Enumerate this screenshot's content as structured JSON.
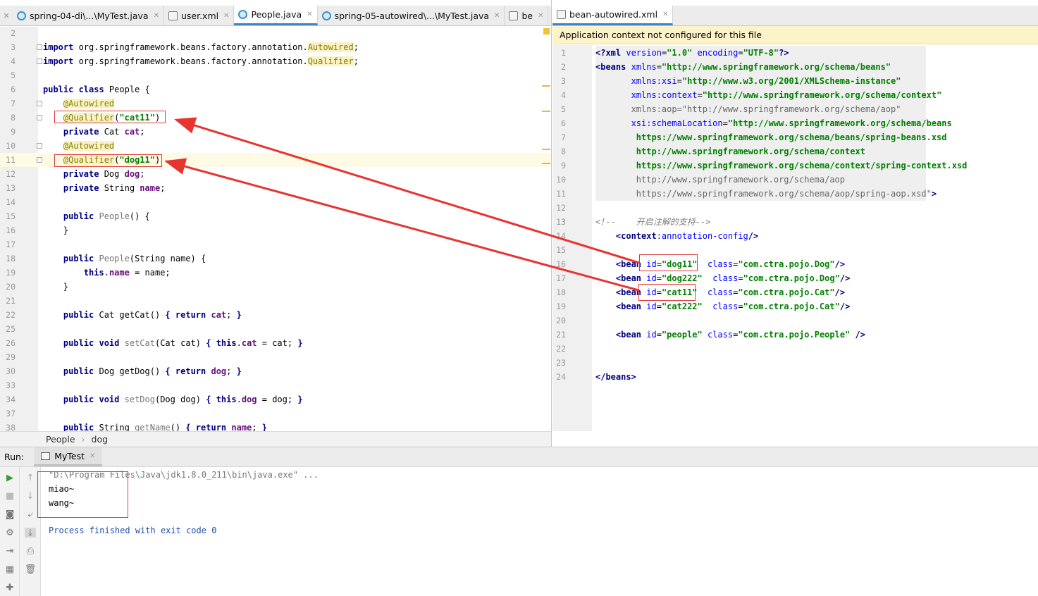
{
  "left_tabs": [
    {
      "label": "spring-04-di\\...\\MyTest.java",
      "icon": "java-class-icon"
    },
    {
      "label": "user.xml",
      "icon": "xml-file-icon"
    },
    {
      "label": "People.java",
      "icon": "java-class-icon",
      "active": true
    },
    {
      "label": "spring-05-autowired\\...\\MyTest.java",
      "icon": "java-class-icon"
    },
    {
      "label": "be",
      "icon": "xml-file-icon"
    }
  ],
  "left_tabs_overflow": "6",
  "right_tab": {
    "label": "bean-autowired.xml",
    "icon": "xml-file-icon"
  },
  "java_code": {
    "lines": [
      {
        "n": "2",
        "html": ""
      },
      {
        "n": "3",
        "html": "<span class=\"kw\">import</span> org.springframework.beans.factory.annotation.<span class=\"ann\">Autowired</span>;"
      },
      {
        "n": "4",
        "html": "<span class=\"kw\">import</span> org.springframework.beans.factory.annotation.<span class=\"ann\">Qualifier</span>;"
      },
      {
        "n": "5",
        "html": ""
      },
      {
        "n": "6",
        "html": "<span class=\"kw\">public class</span> People {"
      },
      {
        "n": "7",
        "html": "    <span class=\"ann\">@Autowired</span>"
      },
      {
        "n": "8",
        "html": "    <span class=\"ann\">@Qualifier</span>(<span class=\"str\">\"cat11\"</span>)"
      },
      {
        "n": "9",
        "html": "    <span class=\"kw\">private</span> Cat <span class=\"fld\">cat</span>;"
      },
      {
        "n": "10",
        "html": "    <span class=\"ann\">@Autowired</span>"
      },
      {
        "n": "11",
        "html": "    <span class=\"ann\">@Qualifier</span>(<span class=\"str\">\"dog11\"</span>)",
        "current": true
      },
      {
        "n": "12",
        "html": "    <span class=\"kw\">private</span> Dog <span class=\"fld\">dog</span>;"
      },
      {
        "n": "13",
        "html": "    <span class=\"kw\">private</span> String <span class=\"fld\">name</span>;"
      },
      {
        "n": "14",
        "html": ""
      },
      {
        "n": "15",
        "html": "    <span class=\"kw\">public</span> <span class=\"meth\">People</span>() {"
      },
      {
        "n": "16",
        "html": "    }"
      },
      {
        "n": "17",
        "html": ""
      },
      {
        "n": "18",
        "html": "    <span class=\"kw\">public</span> <span class=\"meth\">People</span>(String name) {"
      },
      {
        "n": "19",
        "html": "        <span class=\"kw\">this</span>.<span class=\"fld\">name</span> = name;"
      },
      {
        "n": "20",
        "html": "    }"
      },
      {
        "n": "21",
        "html": ""
      },
      {
        "n": "22",
        "html": "    <span class=\"kw\">public</span> Cat getCat() <span class=\"kw\">{</span> <span class=\"kw\">return</span> <span class=\"fld\">cat</span>; <span class=\"kw\">}</span>"
      },
      {
        "n": "25",
        "html": ""
      },
      {
        "n": "26",
        "html": "    <span class=\"kw\">public void</span> <span class=\"meth\">setCat</span>(Cat cat) <span class=\"kw\">{</span> <span class=\"kw\">this</span>.<span class=\"fld\">cat</span> = cat; <span class=\"kw\">}</span>"
      },
      {
        "n": "29",
        "html": ""
      },
      {
        "n": "30",
        "html": "    <span class=\"kw\">public</span> Dog getDog() <span class=\"kw\">{</span> <span class=\"kw\">return</span> <span class=\"fld\">dog</span>; <span class=\"kw\">}</span>"
      },
      {
        "n": "33",
        "html": ""
      },
      {
        "n": "34",
        "html": "    <span class=\"kw\">public void</span> <span class=\"meth\">setDog</span>(Dog dog) <span class=\"kw\">{</span> <span class=\"kw\">this</span>.<span class=\"fld\">dog</span> = dog; <span class=\"kw\">}</span>"
      },
      {
        "n": "37",
        "html": ""
      },
      {
        "n": "38",
        "html": "    <span class=\"kw\">public</span> String <span class=\"meth\">getName</span>() <span class=\"kw\">{</span> <span class=\"kw\">return</span> <span class=\"fld\">name</span>; <span class=\"kw\">}</span>"
      }
    ]
  },
  "breadcrumb": [
    "People",
    "dog"
  ],
  "xml_warning": "Application context not configured for this file",
  "xml_code": {
    "lines": [
      {
        "n": "1",
        "html": "<span class=\"tag\">&lt;?xml</span> <span class=\"att\">version</span>=<span class=\"xv\">\"1.0\"</span> <span class=\"att\">encoding</span>=<span class=\"xv\">\"UTF-8\"</span><span class=\"tag\">?&gt;</span>"
      },
      {
        "n": "2",
        "html": "<span class=\"tag\">&lt;beans</span> <span class=\"att\">xmlns</span>=<span class=\"xv\">\"http://www.springframework.org/schema/beans\"</span>"
      },
      {
        "n": "3",
        "html": "       <span class=\"att\">xmlns:xsi</span>=<span class=\"xv\">\"http://www.w3.org/2001/XMLSchema-instance\"</span>"
      },
      {
        "n": "4",
        "html": "       <span class=\"att\">xmlns:context</span>=<span class=\"xv\">\"http://www.springframework.org/schema/context\"</span>"
      },
      {
        "n": "5",
        "html": "       <span class=\"att2\">xmlns:aop=\"http://www.springframework.org/schema/aop\"</span>"
      },
      {
        "n": "6",
        "html": "       <span class=\"att\">xsi:schemaLocation</span>=<span class=\"xv\">\"http://www.springframework.org/schema/beans</span>"
      },
      {
        "n": "7",
        "html": "        <span class=\"xv\">https://www.springframework.org/schema/beans/spring-beans.xsd</span>"
      },
      {
        "n": "8",
        "html": "        <span class=\"xv\">http://www.springframework.org/schema/context</span>"
      },
      {
        "n": "9",
        "html": "        <span class=\"xv\">https://www.springframework.org/schema/context/spring-context.xsd</span>"
      },
      {
        "n": "10",
        "html": "        <span class=\"att2\">http://www.springframework.org/schema/aop</span>"
      },
      {
        "n": "11",
        "html": "        <span class=\"att2\">https://www.springframework.org/schema/aop/spring-aop.xsd\"</span><span class=\"tag\">&gt;</span>"
      },
      {
        "n": "12",
        "html": ""
      },
      {
        "n": "13",
        "html": "<span class=\"cmt\">&lt;!--    开启注解的支持--&gt;</span>"
      },
      {
        "n": "14",
        "html": "    <span class=\"tag\">&lt;context</span><span class=\"att\">:annotation-config</span><span class=\"tag\">/&gt;</span>"
      },
      {
        "n": "15",
        "html": ""
      },
      {
        "n": "16",
        "html": "    <span class=\"tag\">&lt;bean</span> <span class=\"att\">id</span>=<span class=\"xv\">\"dog11\"</span>  <span class=\"att\">class</span>=<span class=\"xv\">\"com.ctra.pojo.Dog\"</span><span class=\"tag\">/&gt;</span>"
      },
      {
        "n": "17",
        "html": "    <span class=\"tag\">&lt;bean</span> <span class=\"att\">id</span>=<span class=\"xv\">\"dog222\"</span>  <span class=\"att\">class</span>=<span class=\"xv\">\"com.ctra.pojo.Dog\"</span><span class=\"tag\">/&gt;</span>"
      },
      {
        "n": "18",
        "html": "    <span class=\"tag\">&lt;bean</span> <span class=\"att\">id</span>=<span class=\"xv\">\"cat11\"</span>  <span class=\"att\">class</span>=<span class=\"xv\">\"com.ctra.pojo.Cat\"</span><span class=\"tag\">/&gt;</span>"
      },
      {
        "n": "19",
        "html": "    <span class=\"tag\">&lt;bean</span> <span class=\"att\">id</span>=<span class=\"xv\">\"cat222\"</span>  <span class=\"att\">class</span>=<span class=\"xv\">\"com.ctra.pojo.Cat\"</span><span class=\"tag\">/&gt;</span>"
      },
      {
        "n": "20",
        "html": ""
      },
      {
        "n": "21",
        "html": "    <span class=\"tag\">&lt;bean</span> <span class=\"att\">id</span>=<span class=\"xv\">\"people\"</span> <span class=\"att\">class</span>=<span class=\"xv\">\"com.ctra.pojo.People\"</span> <span class=\"tag\">/&gt;</span>"
      },
      {
        "n": "22",
        "html": ""
      },
      {
        "n": "23",
        "html": ""
      },
      {
        "n": "24",
        "html": "<span class=\"tag\">&lt;/beans&gt;</span>"
      }
    ]
  },
  "run": {
    "label": "Run:",
    "tab": "MyTest",
    "output": [
      "\"D:\\Program Files\\Java\\jdk1.8.0_211\\bin\\java.exe\" ...",
      "miao~",
      "wang~",
      "",
      "Process finished with exit code 0"
    ]
  },
  "colors": {
    "annotation_box": "#e23a3a",
    "arrow": "#e8332f"
  }
}
